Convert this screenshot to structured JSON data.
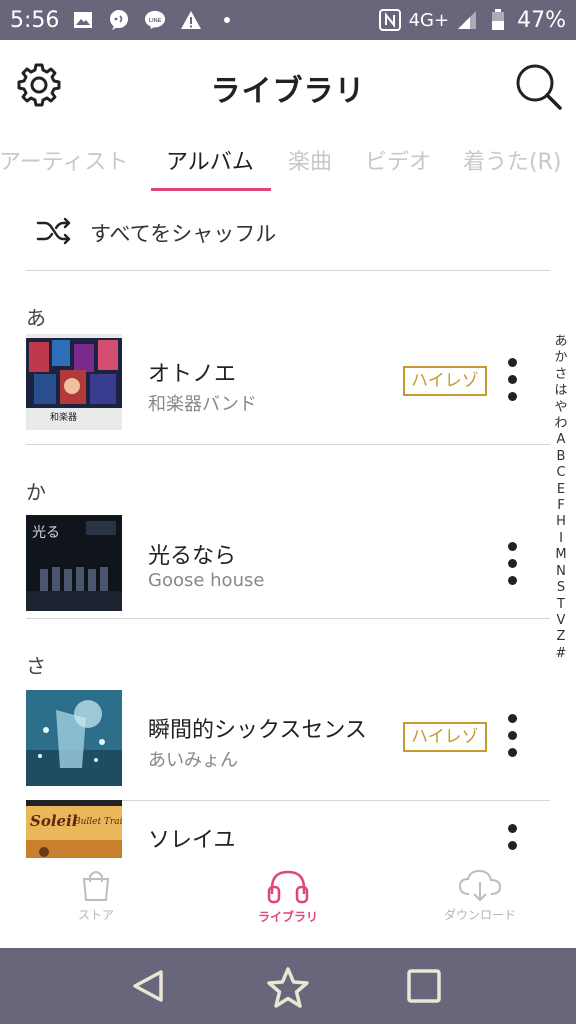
{
  "status_bar": {
    "time": "5:56",
    "network": "4G+",
    "battery": "47%",
    "icons": [
      "image-icon",
      "message-icon",
      "line-icon",
      "warning-icon",
      "dot-icon",
      "nfc-icon",
      "signal-icon",
      "battery-icon"
    ]
  },
  "header": {
    "title": "ライブラリ",
    "left_icon": "gear-icon",
    "right_icon": "search-icon"
  },
  "tabs": [
    {
      "label": "アーティスト",
      "active": false
    },
    {
      "label": "アルバム",
      "active": true
    },
    {
      "label": "楽曲",
      "active": false
    },
    {
      "label": "ビデオ",
      "active": false
    },
    {
      "label": "着うた(R)",
      "active": false
    }
  ],
  "shuffle": {
    "label": "すべてをシャッフル",
    "icon": "shuffle-icon"
  },
  "sections": [
    {
      "head": "あ",
      "items": [
        {
          "title": "オトノエ",
          "artist": "和楽器バンド",
          "badge": "ハイレゾ"
        }
      ]
    },
    {
      "head": "か",
      "items": [
        {
          "title": "光るなら",
          "artist": "Goose house",
          "badge": ""
        }
      ]
    },
    {
      "head": "さ",
      "items": [
        {
          "title": "瞬間的シックスセンス",
          "artist": "あいみょん",
          "badge": "ハイレゾ"
        },
        {
          "title": "ソレイユ",
          "artist": "",
          "badge": ""
        }
      ]
    }
  ],
  "index_bar": [
    "あ",
    "か",
    "さ",
    "は",
    "や",
    "わ",
    "A",
    "B",
    "C",
    "E",
    "F",
    "H",
    "I",
    "M",
    "N",
    "S",
    "T",
    "V",
    "Z",
    "#"
  ],
  "bottom_nav": [
    {
      "label": "ストア",
      "icon": "shopping-bag-icon",
      "active": false
    },
    {
      "label": "ライブラリ",
      "icon": "headphones-icon",
      "active": true
    },
    {
      "label": "ダウンロード",
      "icon": "cloud-download-icon",
      "active": false
    }
  ],
  "system_nav": {
    "back": "back-icon",
    "home": "star-icon",
    "recents": "recents-icon"
  },
  "colors": {
    "accent": "#e0457b",
    "hires": "#c59a2f",
    "status_bar": "#68667a"
  }
}
